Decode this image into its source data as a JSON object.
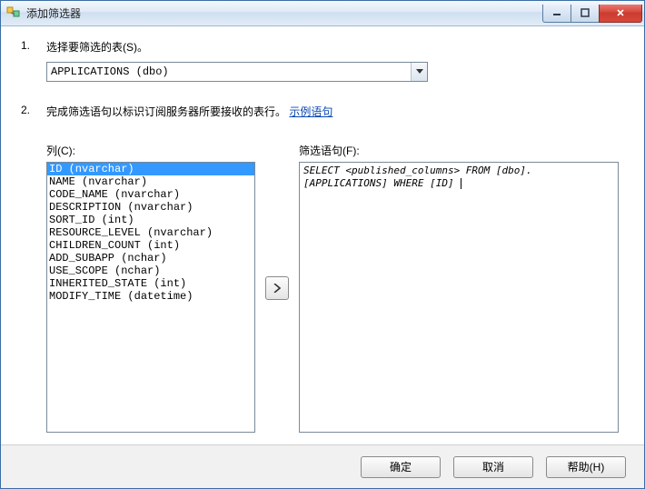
{
  "window": {
    "title": "添加筛选器"
  },
  "step1": {
    "num": "1.",
    "text": "选择要筛选的表(S)。",
    "combo_value": "APPLICATIONS (dbo)"
  },
  "step2": {
    "num": "2.",
    "text_prefix": "完成筛选语句以标识订阅服务器所要接收的表行。",
    "link": "示例语句"
  },
  "columns": {
    "label": "列(C):",
    "items": [
      "ID (nvarchar)",
      "NAME (nvarchar)",
      "CODE_NAME (nvarchar)",
      "DESCRIPTION (nvarchar)",
      "SORT_ID (int)",
      "RESOURCE_LEVEL (nvarchar)",
      "CHILDREN_COUNT (int)",
      "ADD_SUBAPP (nchar)",
      "USE_SCOPE (nchar)",
      "INHERITED_STATE (int)",
      "MODIFY_TIME (datetime)"
    ],
    "selected_index": 0
  },
  "filter": {
    "label": "筛选语句(F):",
    "text": "SELECT <published_columns> FROM [dbo].[APPLICATIONS] WHERE [ID] "
  },
  "buttons": {
    "ok": "确定",
    "cancel": "取消",
    "help": "帮助(H)"
  }
}
